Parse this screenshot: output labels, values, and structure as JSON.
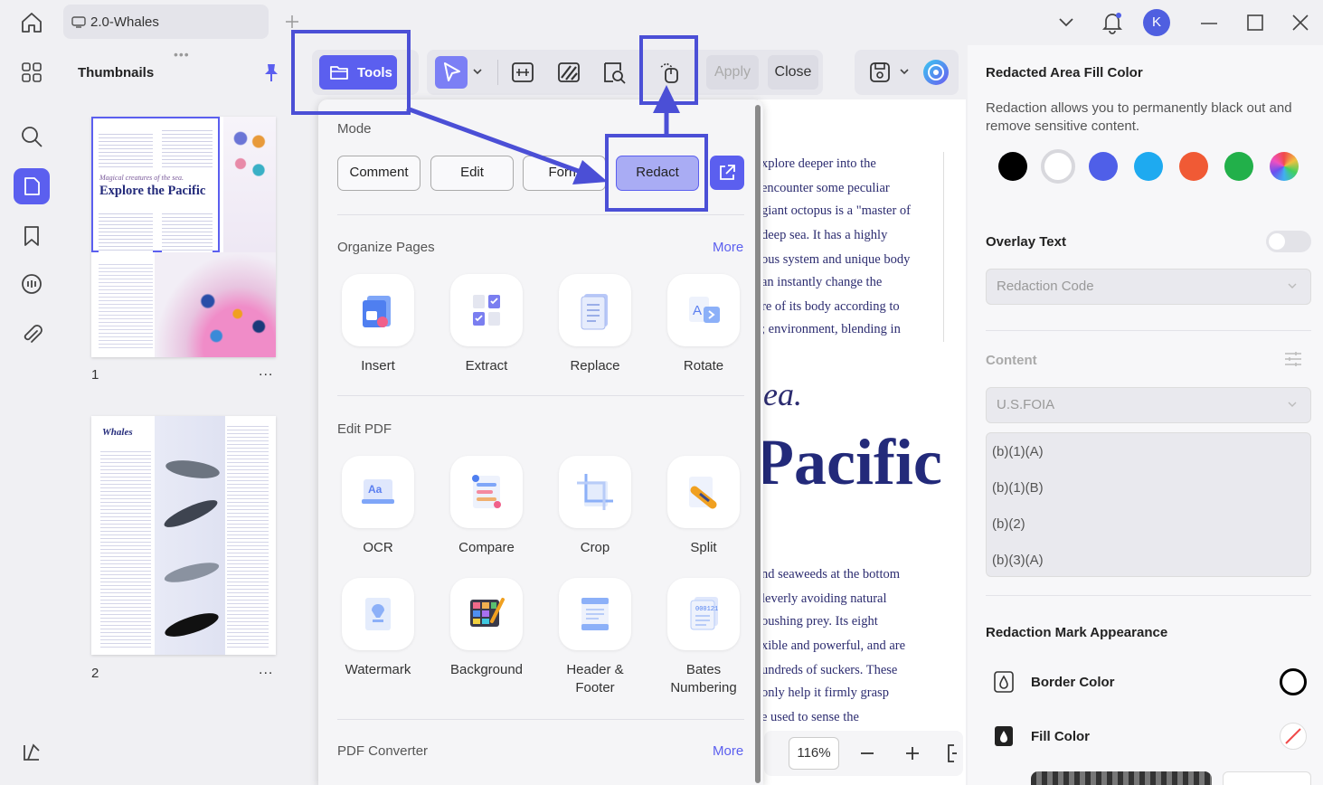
{
  "titlebar": {
    "tab_title": "2.0-Whales",
    "avatar_initial": "K"
  },
  "thumbnails": {
    "title": "Thumbnails",
    "pages": [
      {
        "number": "1",
        "heading_small": "Magical creatures of the sea.",
        "heading": "Explore the Pacific"
      },
      {
        "number": "2",
        "heading": "Whales"
      }
    ],
    "more_label": "..."
  },
  "toolbar": {
    "tools_label": "Tools",
    "apply_label": "Apply",
    "close_label": "Close"
  },
  "tools_menu": {
    "mode_label": "Mode",
    "modes": [
      "Comment",
      "Edit",
      "Form",
      "Redact"
    ],
    "active_mode": "Redact",
    "organize": {
      "title": "Organize Pages",
      "more": "More",
      "tools": [
        "Insert",
        "Extract",
        "Replace",
        "Rotate"
      ]
    },
    "edit": {
      "title": "Edit PDF",
      "tools": [
        "OCR",
        "Compare",
        "Crop",
        "Split",
        "Watermark",
        "Background",
        "Header & Footer",
        "Bates Numbering"
      ]
    },
    "converter": {
      "title": "PDF Converter",
      "more": "More"
    }
  },
  "document": {
    "lines_top": [
      "xplore deeper into the",
      "encounter some peculiar",
      "giant octopus is a \"master of",
      "deep sea. It has a highly",
      "ous system and unique body",
      "an instantly change the",
      "re of its body according to",
      "; environment, blending in"
    ],
    "big_line1": "ea.",
    "big_line2": "Pacific",
    "lines_bottom": [
      "nd seaweeds at the bottom",
      "leverly avoiding natural",
      "oushing prey. Its eight",
      "xible and powerful, and are",
      "undreds of suckers. These",
      "only help it firmly grasp",
      "e used to sense the"
    ]
  },
  "zoom": {
    "level": "116%"
  },
  "right_panel": {
    "fill_title": "Redacted Area Fill Color",
    "fill_desc": "Redaction allows you to permanently black out and remove sensitive content.",
    "swatches": [
      "#000000",
      "#ffffff",
      "#4f5fe8",
      "#1eaaf0",
      "#f05a35",
      "#22b04a",
      "rainbow"
    ],
    "overlay_title": "Overlay Text",
    "overlay_enabled": false,
    "redaction_code_placeholder": "Redaction Code",
    "content_title": "Content",
    "content_select": "U.S.FOIA",
    "codes": [
      "(b)(1)(A)",
      "(b)(1)(B)",
      "(b)(2)",
      "(b)(3)(A)"
    ],
    "appearance_title": "Redaction Mark Appearance",
    "border_label": "Border Color",
    "fill_label": "Fill Color"
  }
}
